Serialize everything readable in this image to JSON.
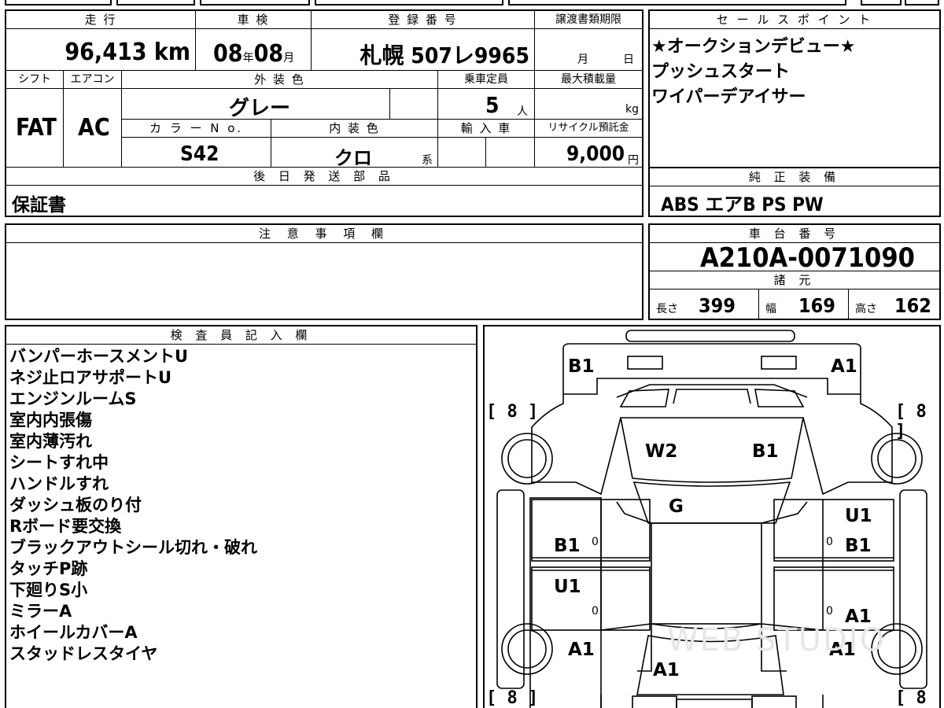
{
  "vehicle": {
    "mileage_header": "走 行",
    "mileage_value": "96,413",
    "mileage_unit": "km",
    "inspection_header": "車 検",
    "inspection_year": "08",
    "inspection_year_unit": "年",
    "inspection_month": "08",
    "inspection_month_unit": "月",
    "registration_header": "登 録 番 号",
    "registration_value": "札幌 507レ9965",
    "transfer_header": "譲渡書類期限",
    "transfer_month_unit": "月",
    "transfer_day_unit": "日",
    "shift_header": "シフト",
    "shift_value": "FAT",
    "ac_header": "エアコン",
    "ac_value": "AC",
    "exterior_header": "外 装 色",
    "exterior_value": "グレー",
    "capacity_header": "乗車定員",
    "capacity_value": "5",
    "capacity_unit": "人",
    "maxload_header": "最大積載量",
    "maxload_unit": "kg",
    "color_no_header": "カ ラ ー N o.",
    "color_no_value": "S42",
    "interior_header": "内 装 色",
    "interior_value": "クロ",
    "interior_unit": "系",
    "import_header": "輸 入 車",
    "recycle_header": "リサイクル預託金",
    "recycle_value": "9,000",
    "recycle_unit": "円"
  },
  "shipping": {
    "header": "後 日 発 送 部 品",
    "value": "保証書"
  },
  "notes": {
    "header": "注 意 事 項 欄"
  },
  "sales": {
    "header": "セ ー ル ス ポ イ ン ト",
    "lines": [
      "★オークションデビュー★",
      "プッシュスタート",
      "ワイパーデアイサー"
    ]
  },
  "equipment": {
    "header": "純 正 装 備",
    "value": "ABS エアB PS PW"
  },
  "chassis": {
    "header": "車 台 番 号",
    "value": "A210A-0071090"
  },
  "specs": {
    "header": "諸 元",
    "length_label": "長さ",
    "length_value": "399",
    "width_label": "幅",
    "width_value": "169",
    "height_label": "高さ",
    "height_value": "162"
  },
  "inspector": {
    "header": "検 査 員 記 入 欄",
    "lines": [
      "バンパーホースメントU",
      "ネジ止ロアサポートU",
      "エンジンルームS",
      "室内内張傷",
      "室内薄汚れ",
      "シートすれ中",
      "ハンドルすれ",
      "ダッシュ板のり付",
      "Rボード要交換",
      "ブラックアウトシール切れ・破れ",
      "タッチP跡",
      "下廻りS小",
      "ミラーA",
      "ホイールカバーA",
      "スタッドレスタイヤ"
    ]
  },
  "diagram": {
    "labels": {
      "front_left_corner": "B1",
      "front_right_corner": "A1",
      "windshield": "W2",
      "windshield_right": "B1",
      "hood": "G",
      "front_right_fender": "U1",
      "left_front_door": "B1",
      "right_front_door": "B1",
      "left_rear_door": "U1",
      "right_rear_door": "A1",
      "left_rear_quarter": "A1",
      "right_rear_quarter": "A1",
      "rear": "A1"
    },
    "tire_depth": "8",
    "door_zero": "0",
    "watermark": "WEB STUDIO"
  }
}
